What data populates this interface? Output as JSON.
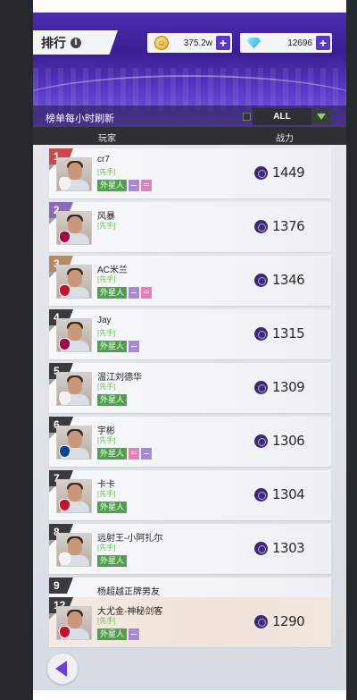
{
  "header": {
    "title": "排行",
    "info_icon": "i",
    "coins": "375.2w",
    "gems": "12696",
    "plus_label": "+",
    "refresh_text": "榜单每小时刷新",
    "filter_value": "ALL"
  },
  "columns": {
    "player": "玩家",
    "power": "战力"
  },
  "colors": {
    "accent": "#5b36c8",
    "rank1": "#c94a4a",
    "rank2": "#8c6ab8",
    "rank3": "#b58a5f",
    "rank_other": "#3a3b40",
    "tag_green": "#4ea34a"
  },
  "rows": [
    {
      "rank": "1",
      "name": "cr7",
      "role": "[先手]",
      "tag": "外星人",
      "extras": [
        "purple",
        "pink"
      ],
      "power": "1449",
      "club": "#f2f2f2"
    },
    {
      "rank": "2",
      "name": "风暴",
      "role": "[先手]",
      "tag": "",
      "extras": [],
      "power": "1376",
      "club": "#a50044"
    },
    {
      "rank": "3",
      "name": "AC米兰",
      "role": "[先手]",
      "tag": "外星人",
      "extras": [
        "purple",
        "pink"
      ],
      "power": "1346",
      "club": "#c8102e"
    },
    {
      "rank": "4",
      "name": "Jay",
      "role": "[先手]",
      "tag": "外星人",
      "extras": [
        "purple"
      ],
      "power": "1315",
      "club": "#a50044"
    },
    {
      "rank": "5",
      "name": "温江刘德华",
      "role": "[先手]",
      "tag": "外星人",
      "extras": [],
      "power": "1309",
      "club": "#f2f2f2"
    },
    {
      "rank": "6",
      "name": "宇彬",
      "role": "[先手]",
      "tag": "外星人",
      "extras": [
        "pink",
        "purple"
      ],
      "power": "1306",
      "club": "#034694"
    },
    {
      "rank": "7",
      "name": "卡卡",
      "role": "[先手]",
      "tag": "外星人",
      "extras": [],
      "power": "1304",
      "club": "#c8102e"
    },
    {
      "rank": "8",
      "name": "远射王-小阿扎尔",
      "role": "[先手]",
      "tag": "外星人",
      "extras": [],
      "power": "1303",
      "club": "#f2f2f2"
    },
    {
      "rank": "9",
      "name": "杨超越正牌男友",
      "role": "",
      "tag": "",
      "extras": [],
      "power": "",
      "club": ""
    }
  ],
  "my_row": {
    "rank": "12",
    "name": "大尤金-神秘剑客",
    "role": "[先手]",
    "tag": "外星人",
    "extras": [
      "purple"
    ],
    "power": "1290",
    "club": "#c8102e"
  }
}
